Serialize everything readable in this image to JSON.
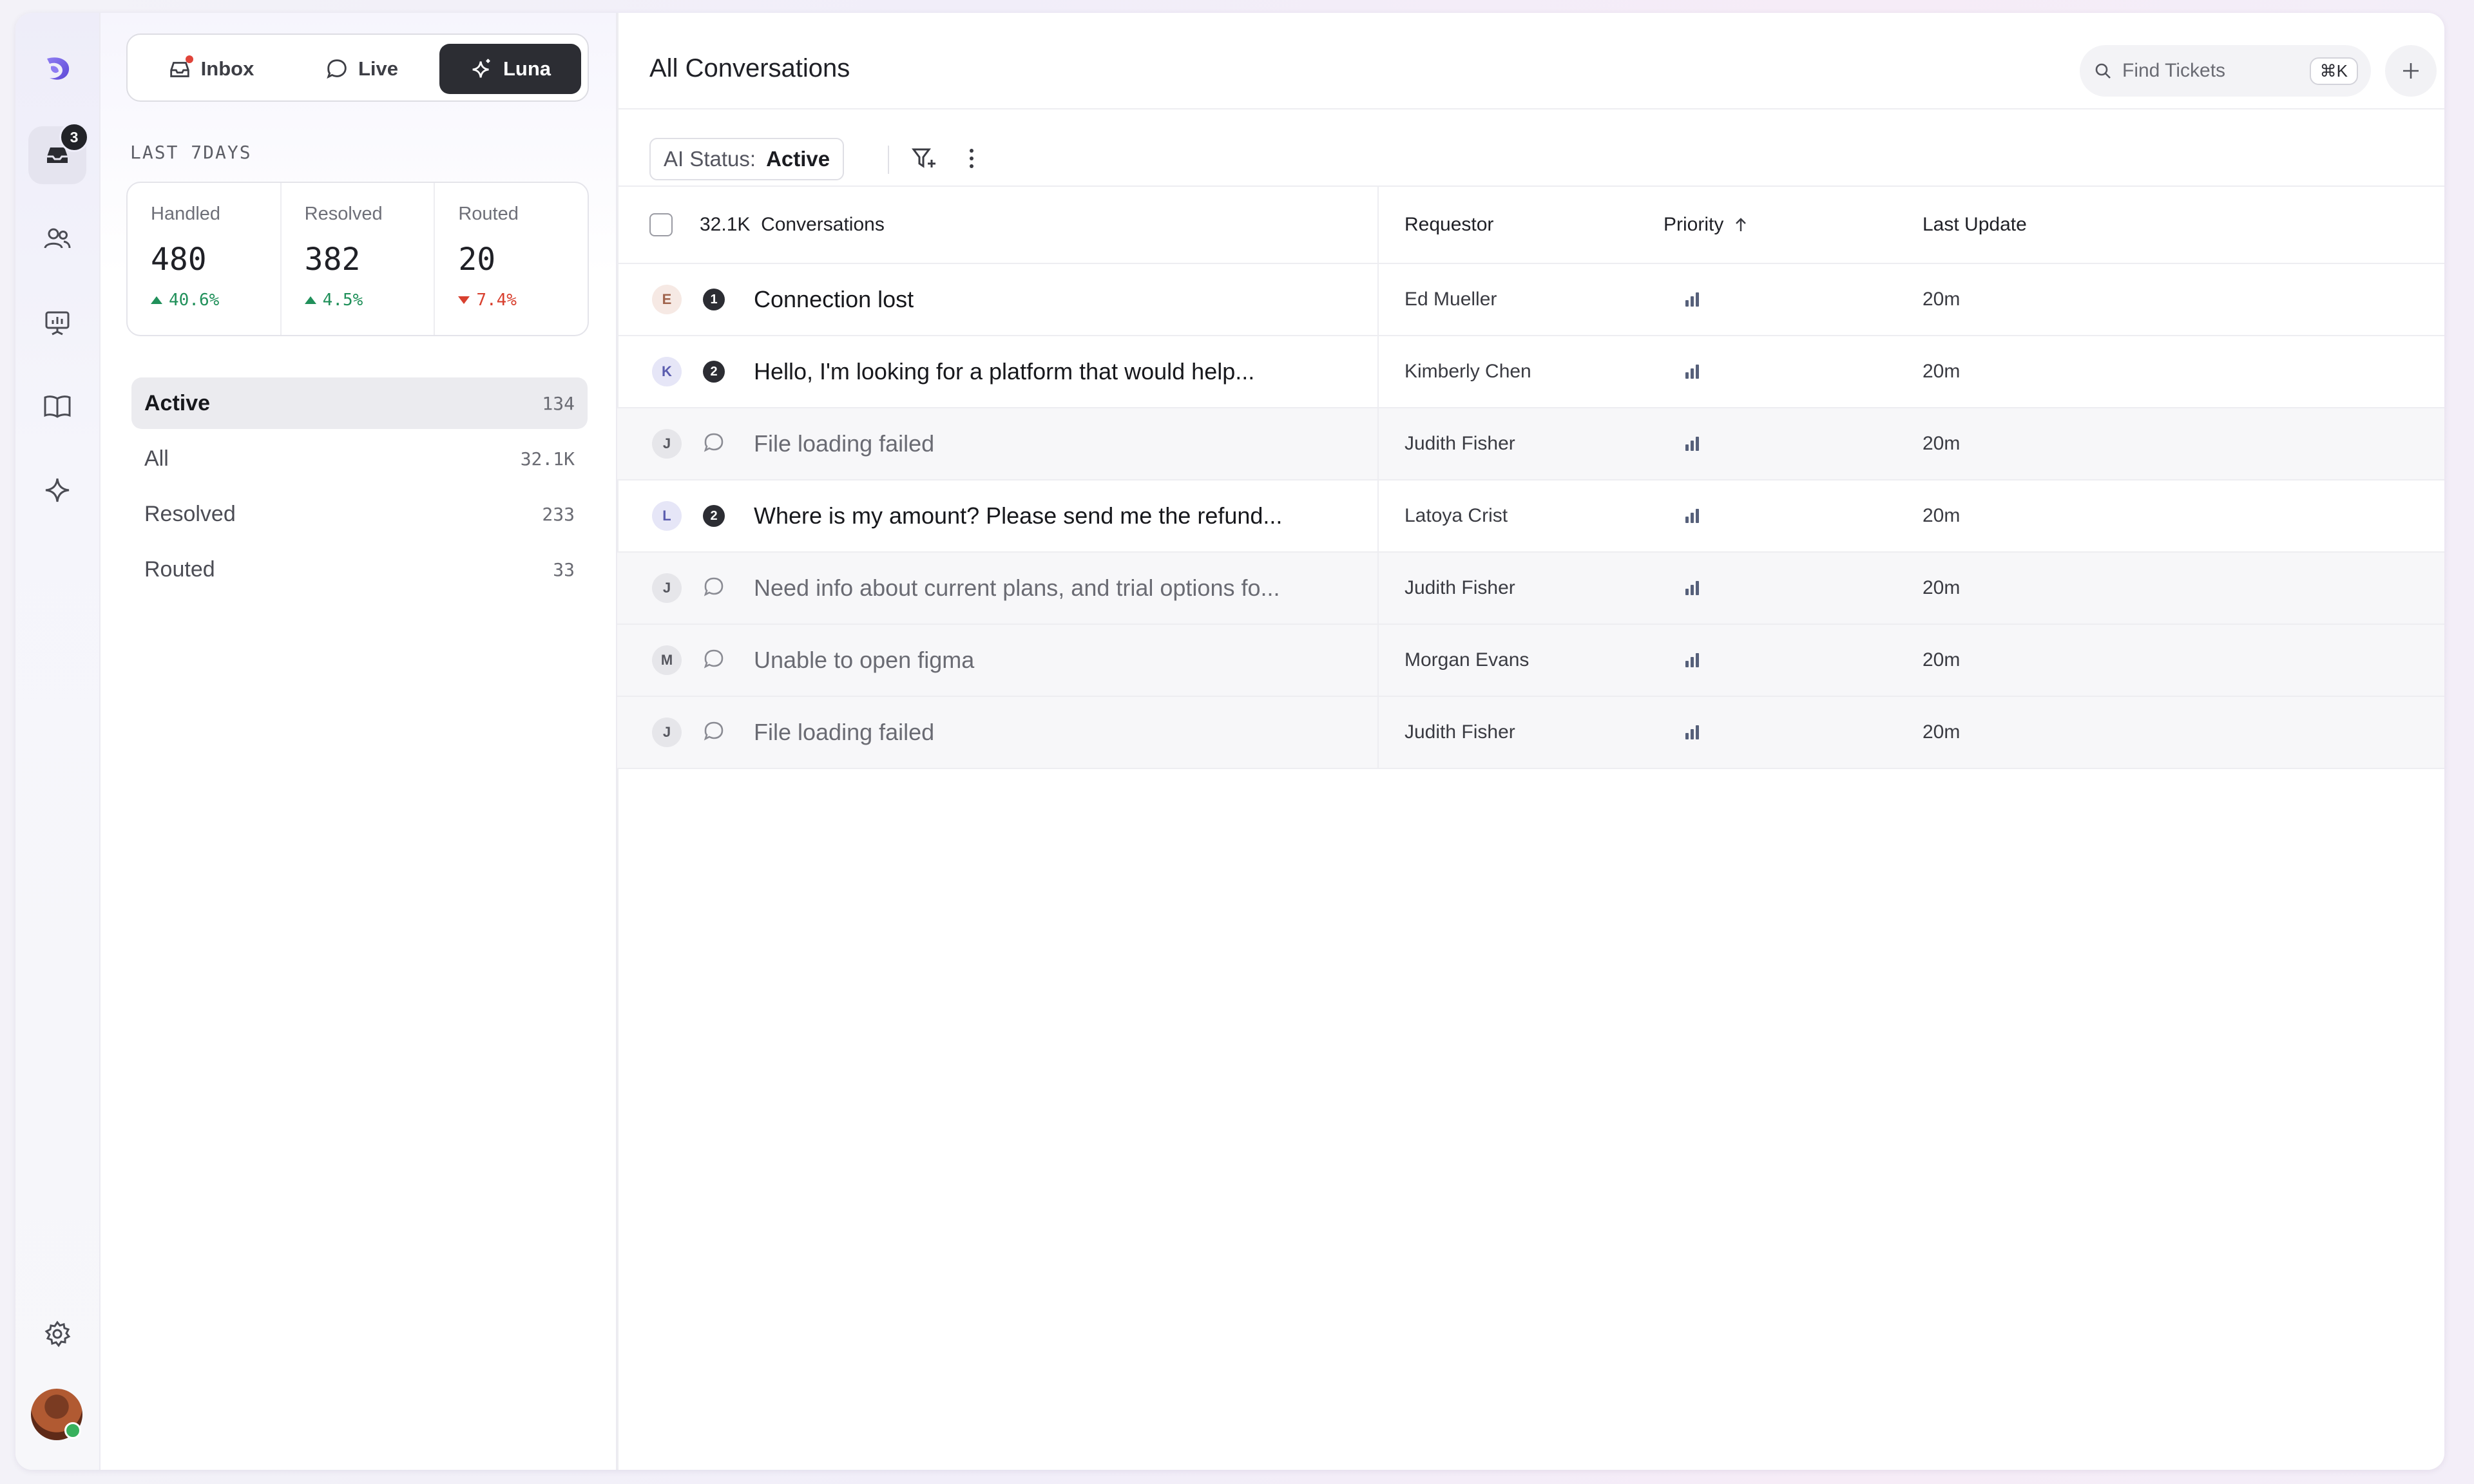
{
  "app": {
    "inbox_badge": "3"
  },
  "segments": [
    {
      "label": "Inbox",
      "icon": "inbox-icon",
      "active": false
    },
    {
      "label": "Live",
      "icon": "chat-bubble-icon",
      "active": false
    },
    {
      "label": "Luna",
      "icon": "sparkle-icon",
      "active": true
    }
  ],
  "period_label": "LAST 7DAYS",
  "stats": [
    {
      "label": "Handled",
      "value": "480",
      "delta": "40.6%",
      "trend": "up"
    },
    {
      "label": "Resolved",
      "value": "382",
      "delta": "4.5%",
      "trend": "up"
    },
    {
      "label": "Routed",
      "value": "20",
      "delta": "7.4%",
      "trend": "down"
    }
  ],
  "views": [
    {
      "label": "Active",
      "count": "134",
      "active": true
    },
    {
      "label": "All",
      "count": "32.1K",
      "active": false
    },
    {
      "label": "Resolved",
      "count": "233",
      "active": false
    },
    {
      "label": "Routed",
      "count": "33",
      "active": false
    }
  ],
  "main": {
    "title": "All Conversations",
    "search_placeholder": "Find Tickets",
    "search_shortcut": "⌘K",
    "filter_key": "AI Status:",
    "filter_value": "Active"
  },
  "table": {
    "count_label": "32.1K  Conversations",
    "headers": {
      "requestor": "Requestor",
      "priority": "Priority",
      "last_update": "Last Update"
    },
    "rows": [
      {
        "initial": "E",
        "avatar_bg": "#f6e9e4",
        "avatar_fg": "#a0634c",
        "marker": "1",
        "subject": "Connection lost",
        "requestor": "Ed Mueller",
        "updated": "20m",
        "unread": true
      },
      {
        "initial": "K",
        "avatar_bg": "#e6e6f7",
        "avatar_fg": "#5a5cae",
        "marker": "2",
        "subject": "Hello, I'm looking for a platform that would help...",
        "requestor": "Kimberly Chen",
        "updated": "20m",
        "unread": true
      },
      {
        "initial": "J",
        "avatar_bg": "#e6e6ea",
        "avatar_fg": "#55565e",
        "marker": "",
        "subject": "File loading failed",
        "requestor": "Judith Fisher",
        "updated": "20m",
        "unread": false
      },
      {
        "initial": "L",
        "avatar_bg": "#e6e6f7",
        "avatar_fg": "#5a5cae",
        "marker": "2",
        "subject": "Where is my amount? Please send me the refund...",
        "requestor": "Latoya Crist",
        "updated": "20m",
        "unread": true
      },
      {
        "initial": "J",
        "avatar_bg": "#e6e6ea",
        "avatar_fg": "#55565e",
        "marker": "",
        "subject": "Need info about current plans, and trial options fo...",
        "requestor": "Judith Fisher",
        "updated": "20m",
        "unread": false
      },
      {
        "initial": "M",
        "avatar_bg": "#e6e6ea",
        "avatar_fg": "#55565e",
        "marker": "",
        "subject": "Unable to open figma",
        "requestor": "Morgan Evans",
        "updated": "20m",
        "unread": false
      },
      {
        "initial": "J",
        "avatar_bg": "#e6e6ea",
        "avatar_fg": "#55565e",
        "marker": "",
        "subject": "File loading failed",
        "requestor": "Judith Fisher",
        "updated": "20m",
        "unread": false
      }
    ]
  }
}
